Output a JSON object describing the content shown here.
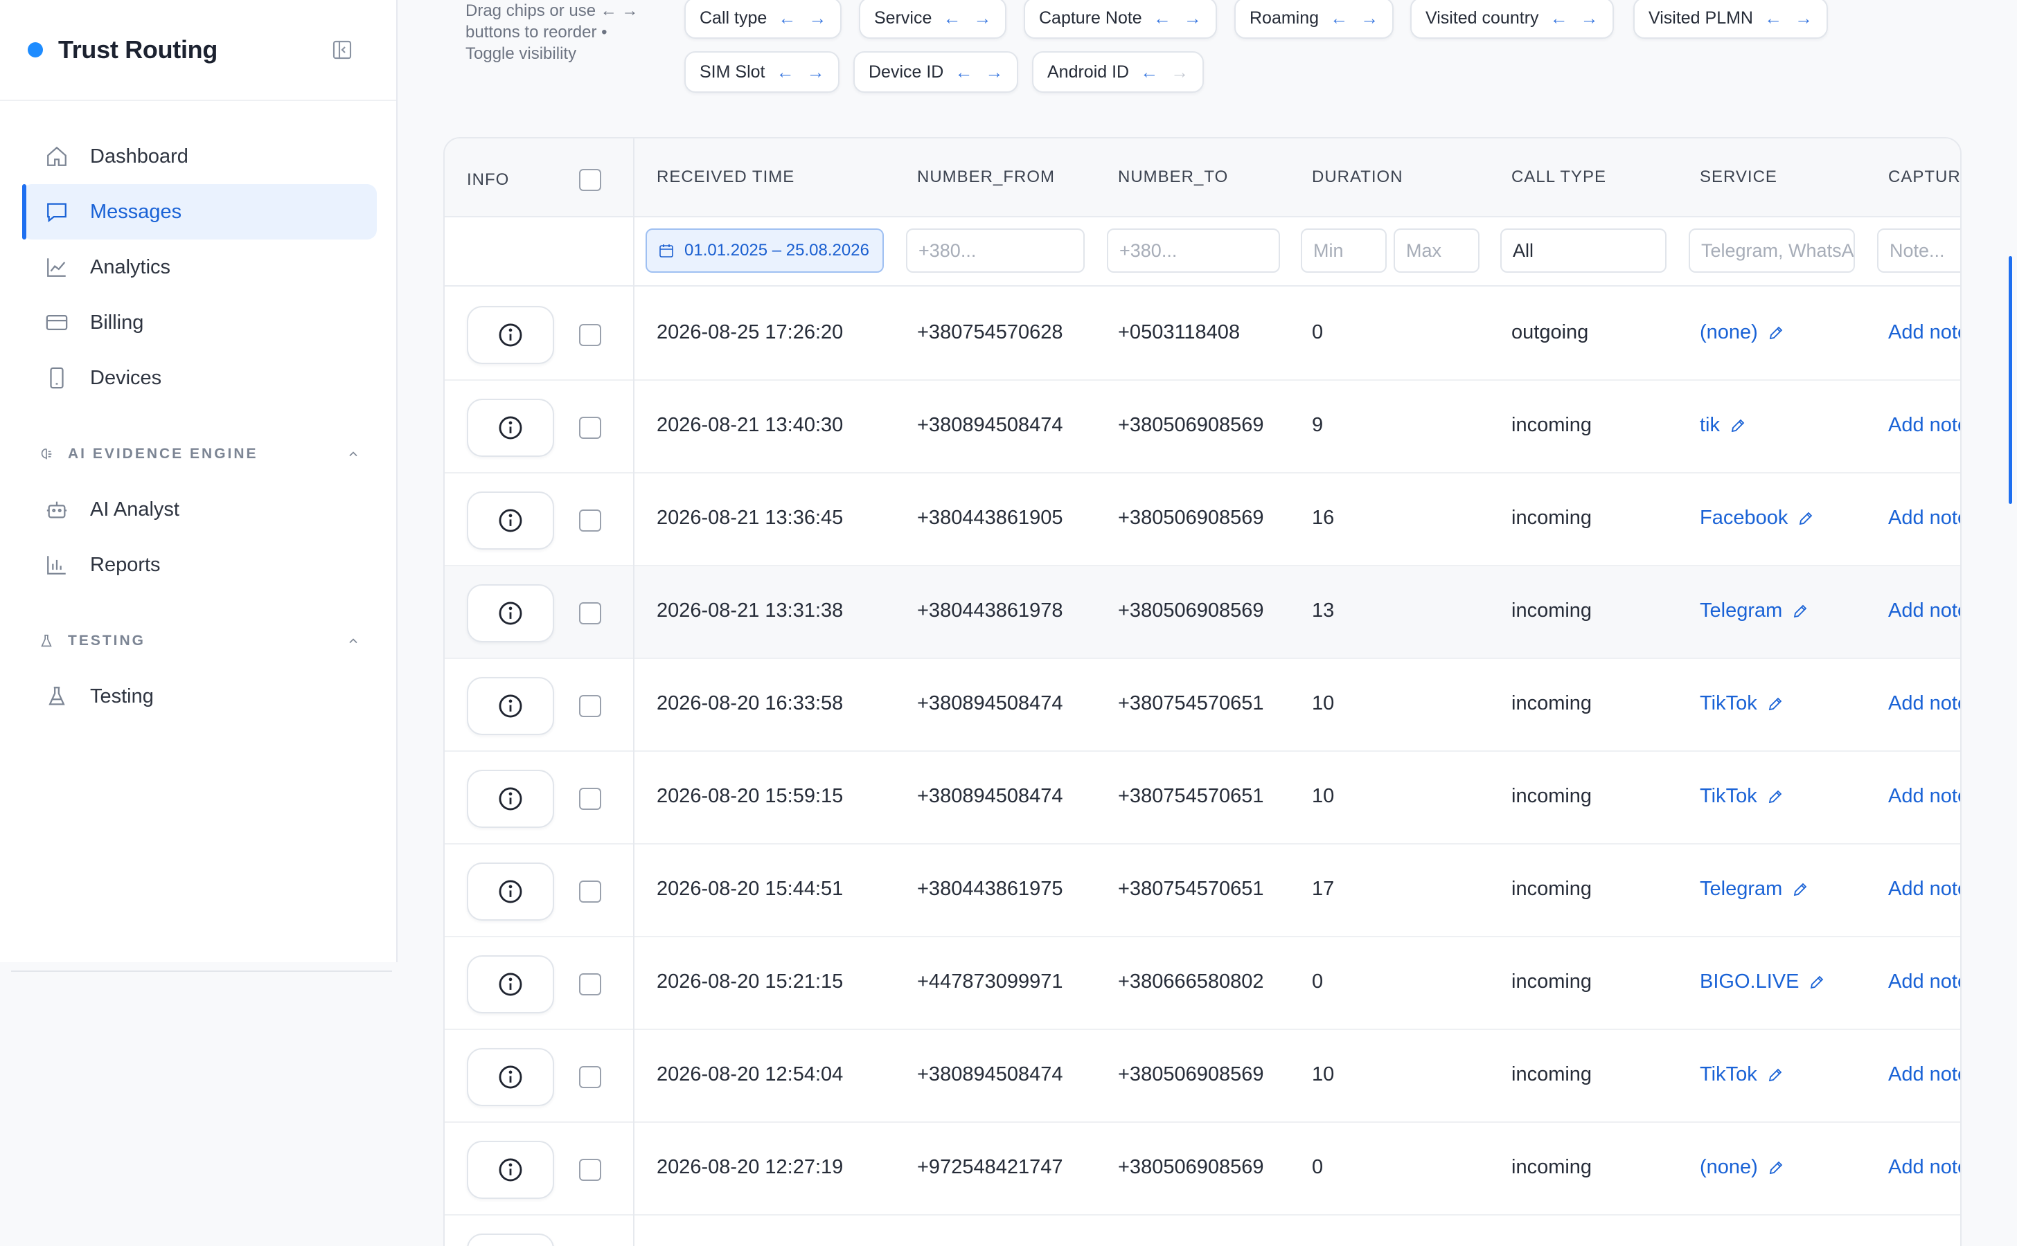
{
  "brand": {
    "name": "Trust Routing",
    "dot_color": "#1e8cff"
  },
  "sidebar": {
    "items": [
      {
        "label": "Dashboard",
        "icon": "home-icon"
      },
      {
        "label": "Messages",
        "icon": "message-icon",
        "active": true
      },
      {
        "label": "Analytics",
        "icon": "chart-line-icon"
      },
      {
        "label": "Billing",
        "icon": "credit-card-icon"
      },
      {
        "label": "Devices",
        "icon": "phone-icon"
      }
    ],
    "sections": [
      {
        "label": "AI EVIDENCE ENGINE",
        "icon": "brain-icon",
        "items": [
          {
            "label": "AI Analyst",
            "icon": "robot-icon"
          },
          {
            "label": "Reports",
            "icon": "bar-chart-icon"
          }
        ]
      },
      {
        "label": "TESTING",
        "icon": "flask-icon",
        "items": [
          {
            "label": "Testing",
            "icon": "flask-icon"
          }
        ]
      }
    ]
  },
  "columns_hint": "Drag chips or use ← → buttons to reorder • Toggle visibility",
  "chips": [
    "Call type",
    "Service",
    "Capture Note",
    "Roaming",
    "Visited country",
    "Visited PLMN",
    "SIM Slot",
    "Device ID",
    "Android ID"
  ],
  "table": {
    "headers": {
      "info": "INFO",
      "received_time": "RECEIVED TIME",
      "number_from": "NUMBER_FROM",
      "number_to": "NUMBER_TO",
      "duration": "DURATION",
      "call_type": "CALL TYPE",
      "service": "SERVICE",
      "capture": "CAPTURE NOTE"
    },
    "filters": {
      "date_range": "01.01.2025 – 25.08.2026",
      "from_placeholder": "+380...",
      "to_placeholder": "+380...",
      "min_placeholder": "Min",
      "max_placeholder": "Max",
      "call_type": "All",
      "service_placeholder": "Telegram, WhatsApp",
      "note_placeholder": "Note..."
    },
    "add_note_label": "Add note",
    "rows": [
      {
        "time": "2026-08-25 17:26:20",
        "from": "+380754570628",
        "to": "+0503118408",
        "duration": "0",
        "call_type": "outgoing",
        "service": "(none)"
      },
      {
        "time": "2026-08-21 13:40:30",
        "from": "+380894508474",
        "to": "+380506908569",
        "duration": "9",
        "call_type": "incoming",
        "service": "tik"
      },
      {
        "time": "2026-08-21 13:36:45",
        "from": "+380443861905",
        "to": "+380506908569",
        "duration": "16",
        "call_type": "incoming",
        "service": "Facebook"
      },
      {
        "time": "2026-08-21 13:31:38",
        "from": "+380443861978",
        "to": "+380506908569",
        "duration": "13",
        "call_type": "incoming",
        "service": "Telegram"
      },
      {
        "time": "2026-08-20 16:33:58",
        "from": "+380894508474",
        "to": "+380754570651",
        "duration": "10",
        "call_type": "incoming",
        "service": "TikTok"
      },
      {
        "time": "2026-08-20 15:59:15",
        "from": "+380894508474",
        "to": "+380754570651",
        "duration": "10",
        "call_type": "incoming",
        "service": "TikTok"
      },
      {
        "time": "2026-08-20 15:44:51",
        "from": "+380443861975",
        "to": "+380754570651",
        "duration": "17",
        "call_type": "incoming",
        "service": "Telegram"
      },
      {
        "time": "2026-08-20 15:21:15",
        "from": "+447873099971",
        "to": "+380666580802",
        "duration": "0",
        "call_type": "incoming",
        "service": "BIGO.LIVE"
      },
      {
        "time": "2026-08-20 12:54:04",
        "from": "+380894508474",
        "to": "+380506908569",
        "duration": "10",
        "call_type": "incoming",
        "service": "TikTok"
      },
      {
        "time": "2026-08-20 12:27:19",
        "from": "+972548421747",
        "to": "+380506908569",
        "duration": "0",
        "call_type": "incoming",
        "service": "(none)"
      }
    ]
  },
  "colors": {
    "accent": "#1962d6",
    "active_bg": "#eaf2fe"
  }
}
